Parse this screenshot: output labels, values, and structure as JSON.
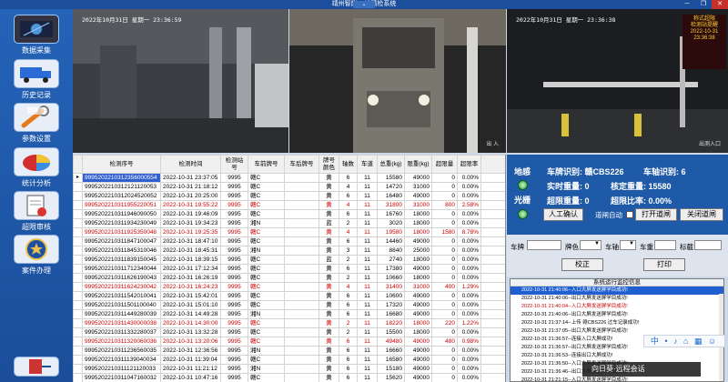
{
  "window": {
    "title": "靖州智能....站精检系统",
    "collapse_glyph": "⌄",
    "min_glyph": "─",
    "max_glyph": "❐",
    "close_glyph": "✕"
  },
  "sidebar": {
    "items": [
      {
        "label": "数据采集",
        "icon": "data-collect-icon"
      },
      {
        "label": "历史记录",
        "icon": "truck-history-icon"
      },
      {
        "label": "参数设置",
        "icon": "wrench-settings-icon"
      },
      {
        "label": "统计分析",
        "icon": "pie-chart-icon"
      },
      {
        "label": "超限审核",
        "icon": "audit-document-icon"
      },
      {
        "label": "案件办理",
        "icon": "police-badge-icon"
      },
      {
        "label": "",
        "icon": "exit-door-icon"
      }
    ]
  },
  "cameras": [
    {
      "timestamp": "2022年10月31日 星期一 23:36:59",
      "caption": ""
    },
    {
      "timestamp": "",
      "caption": "出 入"
    },
    {
      "timestamp": "2022年10月31日 星期一 23:36:38",
      "caption": "出测入口",
      "sign_text": "称式超限\n检测站提醒\n2022-10-31\n23:36:38"
    }
  ],
  "table": {
    "headers": [
      "检测序号",
      "检测时间",
      "检测站号",
      "车前牌号",
      "车后牌号",
      "牌号颜色",
      "轴数",
      "车道",
      "总重(kg)",
      "限重(kg)",
      "超限量",
      "超限率"
    ],
    "rows": [
      {
        "id": "9995202210312356000554",
        "time": "2022-10-31 23:37:05",
        "station": "9995",
        "front": "赣C",
        "back": "",
        "color": "黄",
        "axles": "6",
        "lane": "11",
        "total": "15580",
        "limit": "49000",
        "over": "0",
        "rate": "0.00%",
        "flag": "normal",
        "selected": true
      },
      {
        "id": "9995202210312121120053",
        "time": "2022-10-31 21:18:12",
        "station": "9995",
        "front": "赣C",
        "back": "",
        "color": "黄",
        "axles": "4",
        "lane": "11",
        "total": "14720",
        "limit": "31000",
        "over": "0",
        "rate": "0.00%",
        "flag": "normal"
      },
      {
        "id": "9995202210312024520052",
        "time": "2022-10-31 20:25:00",
        "station": "9995",
        "front": "赣C",
        "back": "",
        "color": "黄",
        "axles": "6",
        "lane": "11",
        "total": "16480",
        "limit": "49000",
        "over": "0",
        "rate": "0.00%",
        "flag": "normal"
      },
      {
        "id": "9995202210311955220051",
        "time": "2022-10-31 19:55:22",
        "station": "9995",
        "front": "赣C",
        "back": "",
        "color": "黄",
        "axles": "4",
        "lane": "11",
        "total": "31800",
        "limit": "31000",
        "over": "800",
        "rate": "2.58%",
        "flag": "over"
      },
      {
        "id": "9995202210311946090050",
        "time": "2022-10-31 19:46:09",
        "station": "9995",
        "front": "赣C",
        "back": "",
        "color": "黄",
        "axles": "6",
        "lane": "11",
        "total": "16760",
        "limit": "18000",
        "over": "0",
        "rate": "0.00%",
        "flag": "normal"
      },
      {
        "id": "9995202210311934230049",
        "time": "2022-10-31 19:34:23",
        "station": "9995",
        "front": "湘N",
        "back": "",
        "color": "蓝",
        "axles": "2",
        "lane": "11",
        "total": "3020",
        "limit": "18000",
        "over": "0",
        "rate": "0.00%",
        "flag": "normal"
      },
      {
        "id": "9995202210311925350048",
        "time": "2022-10-31 19:25:35",
        "station": "9995",
        "front": "赣C",
        "back": "",
        "color": "黄",
        "axles": "4",
        "lane": "11",
        "total": "19580",
        "limit": "18000",
        "over": "1580",
        "rate": "8.78%",
        "flag": "over"
      },
      {
        "id": "9995202210311847100047",
        "time": "2022-10-31 18:47:10",
        "station": "9995",
        "front": "赣C",
        "back": "",
        "color": "黄",
        "axles": "6",
        "lane": "11",
        "total": "14460",
        "limit": "49000",
        "over": "0",
        "rate": "0.00%",
        "flag": "normal"
      },
      {
        "id": "9995202210311845310046",
        "time": "2022-10-31 18:45:31",
        "station": "9995",
        "front": "湘N",
        "back": "",
        "color": "黄",
        "axles": "3",
        "lane": "11",
        "total": "8840",
        "limit": "25000",
        "over": "0",
        "rate": "0.00%",
        "flag": "normal"
      },
      {
        "id": "9995202210311839150045",
        "time": "2022-10-31 18:39:15",
        "station": "9995",
        "front": "赣C",
        "back": "",
        "color": "蓝",
        "axles": "2",
        "lane": "11",
        "total": "2740",
        "limit": "18000",
        "over": "0",
        "rate": "0.00%",
        "flag": "normal"
      },
      {
        "id": "9995202210311712340044",
        "time": "2022-10-31 17:12:34",
        "station": "9995",
        "front": "赣C",
        "back": "",
        "color": "黄",
        "axles": "6",
        "lane": "11",
        "total": "17380",
        "limit": "49000",
        "over": "0",
        "rate": "0.00%",
        "flag": "normal"
      },
      {
        "id": "9995202210311626190043",
        "time": "2022-10-31 16:26:19",
        "station": "9995",
        "front": "赣C",
        "back": "",
        "color": "黄",
        "axles": "2",
        "lane": "11",
        "total": "10660",
        "limit": "18000",
        "over": "0",
        "rate": "0.00%",
        "flag": "normal"
      },
      {
        "id": "9995202210311624230042",
        "time": "2022-10-31 16:24:23",
        "station": "9995",
        "front": "赣C",
        "back": "",
        "color": "黄",
        "axles": "4",
        "lane": "11",
        "total": "31400",
        "limit": "31000",
        "over": "400",
        "rate": "1.29%",
        "flag": "over"
      },
      {
        "id": "9995202210311542010041",
        "time": "2022-10-31 15:42:01",
        "station": "9995",
        "front": "赣C",
        "back": "",
        "color": "黄",
        "axles": "6",
        "lane": "11",
        "total": "10600",
        "limit": "49000",
        "over": "0",
        "rate": "0.00%",
        "flag": "normal"
      },
      {
        "id": "9995202210311501100040",
        "time": "2022-10-31 15:01:10",
        "station": "9995",
        "front": "赣C",
        "back": "",
        "color": "黄",
        "axles": "6",
        "lane": "11",
        "total": "17320",
        "limit": "49000",
        "over": "0",
        "rate": "0.00%",
        "flag": "normal"
      },
      {
        "id": "9995202210311449280039",
        "time": "2022-10-31 14:49:28",
        "station": "9995",
        "front": "湘N",
        "back": "",
        "color": "黄",
        "axles": "6",
        "lane": "11",
        "total": "16680",
        "limit": "49000",
        "over": "0",
        "rate": "0.00%",
        "flag": "normal"
      },
      {
        "id": "9995202210311430000038",
        "time": "2022-10-31 14:30:00",
        "station": "9995",
        "front": "赣C",
        "back": "",
        "color": "黄",
        "axles": "2",
        "lane": "11",
        "total": "18220",
        "limit": "18000",
        "over": "220",
        "rate": "1.22%",
        "flag": "over"
      },
      {
        "id": "9995202210311332280037",
        "time": "2022-10-31 13:32:28",
        "station": "9995",
        "front": "赣C",
        "back": "",
        "color": "黄",
        "axles": "2",
        "lane": "11",
        "total": "15500",
        "limit": "18000",
        "over": "0",
        "rate": "0.00%",
        "flag": "normal"
      },
      {
        "id": "9995202210311320060036",
        "time": "2022-10-31 13:20:06",
        "station": "9995",
        "front": "赣C",
        "back": "",
        "color": "黄",
        "axles": "6",
        "lane": "11",
        "total": "49480",
        "limit": "49000",
        "over": "480",
        "rate": "0.98%",
        "flag": "over"
      },
      {
        "id": "9995202210311236560035",
        "time": "2022-10-31 12:36:56",
        "station": "9995",
        "front": "湘N",
        "back": "",
        "color": "黄",
        "axles": "6",
        "lane": "11",
        "total": "16660",
        "limit": "49000",
        "over": "0",
        "rate": "0.00%",
        "flag": "normal"
      },
      {
        "id": "9995202210311139040034",
        "time": "2022-10-31 11:39:04",
        "station": "9995",
        "front": "赣C",
        "back": "",
        "color": "黄",
        "axles": "6",
        "lane": "11",
        "total": "16580",
        "limit": "49000",
        "over": "0",
        "rate": "0.00%",
        "flag": "normal"
      },
      {
        "id": "9995202210311121120033",
        "time": "2022-10-31 11:21:12",
        "station": "9995",
        "front": "湘N",
        "back": "",
        "color": "黄",
        "axles": "6",
        "lane": "11",
        "total": "15180",
        "limit": "49000",
        "over": "0",
        "rate": "0.00%",
        "flag": "normal"
      },
      {
        "id": "9995202210311047160032",
        "time": "2022-10-31 10:47:16",
        "station": "9995",
        "front": "赣C",
        "back": "",
        "color": "黄",
        "axles": "6",
        "lane": "11",
        "total": "15620",
        "limit": "49000",
        "over": "0",
        "rate": "0.00%",
        "flag": "normal"
      }
    ]
  },
  "status_panel": {
    "ground_sense_label": "地感",
    "light_curtain_label": "光栅",
    "plate_label": "车牌识别:",
    "plate_value": "赣CBS226",
    "axle_label": "车轴识别:",
    "axle_value": "6",
    "actual_weight_label": "实时重量:",
    "actual_weight_value": "0",
    "rated_weight_label": "核定重量:",
    "rated_weight_value": "15580",
    "over_weight_label": "超限重量:",
    "over_weight_value": "0",
    "over_rate_label": "超限比率:",
    "over_rate_value": "0.00%",
    "manual_confirm": "人工确认",
    "auto_label": "道闸自动",
    "open_gate": "打开道闸",
    "close_gate": "关闭道闸"
  },
  "filter": {
    "plate_label": "车牌",
    "color_label": "牌色",
    "axle_label": "车轴",
    "weight_label": "车重",
    "flag_label": "标截",
    "correct_btn": "校正",
    "print_btn": "打印"
  },
  "monitor": {
    "title": "系统运行监控信息",
    "logs": [
      {
        "text": "2022-10-31 21:40:06--入口大屏发送屏学目成功!",
        "style": "sel"
      },
      {
        "text": "2022-10-31 21:40:06--出口大屏发送屏学目成功!",
        "style": "normal"
      },
      {
        "text": "2022-10-31 21:40:04--入口大屏发送屏学目成功!",
        "style": "red"
      },
      {
        "text": "2022-10-31 21:40:06--出口大屏发送屏学目成功!",
        "style": "normal"
      },
      {
        "text": "2022-10-31 21:37:14--上传 赣CBS226 过车记录成功!",
        "style": "normal"
      },
      {
        "text": "2022-10-31 21:37:05--出口大屏发送屏学目成功!",
        "style": "normal"
      },
      {
        "text": "2022-10-31 21:36:57--连接入口大屏成功!",
        "style": "normal"
      },
      {
        "text": "2022-10-31 21:36:57--出口大屏发送屏学目成功!",
        "style": "normal"
      },
      {
        "text": "2022-10-31 21:36:53--连接出口大屏成功!",
        "style": "normal"
      },
      {
        "text": "2022-10-31 21:36:50--入口大屏发送屏学目成功!",
        "style": "normal"
      },
      {
        "text": "2022-10-31 21:36:46--出口大屏发送屏学目成功!",
        "style": "normal"
      },
      {
        "text": "2022-10-31 21:21:15--入口大屏发送屏学目成功!",
        "style": "normal"
      }
    ]
  },
  "ime_bar": "中 • ♪ ⌂ ▦ ☺",
  "toast": "向日葵·远程会话"
}
